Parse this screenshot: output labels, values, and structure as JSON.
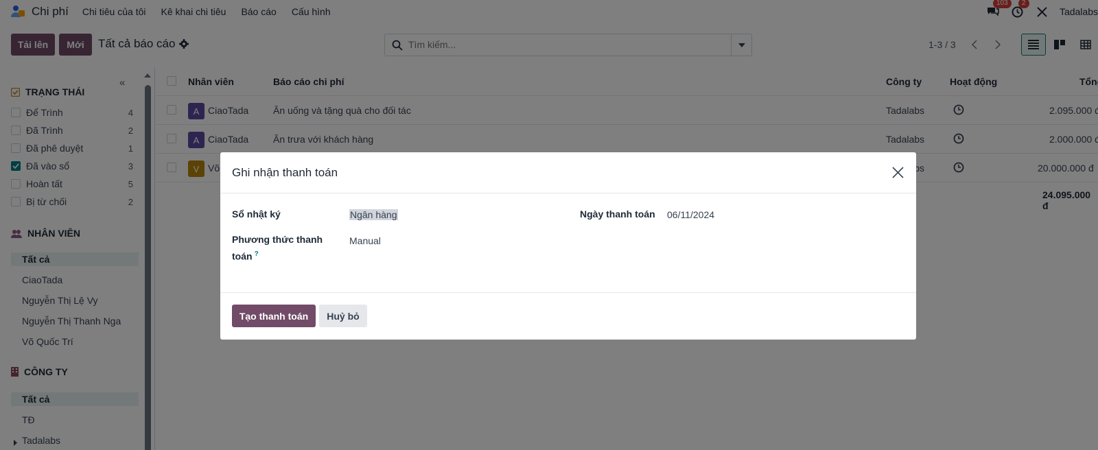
{
  "app": {
    "name": "Chi phí",
    "menu": [
      "Chi tiêu của tôi",
      "Kê khai chi tiêu",
      "Báo cáo",
      "Cấu hình"
    ],
    "messages_badge": "103",
    "activities_badge": "2",
    "company": "Tadalabs"
  },
  "control_panel": {
    "upload_label": "Tải lên",
    "new_label": "Mới",
    "title": "Tất cả báo cáo",
    "search_placeholder": "Tìm kiếm...",
    "pager": "1-3 / 3"
  },
  "sidebar": {
    "status_title": "TRẠNG THÁI",
    "statuses": [
      {
        "label": "Để Trình",
        "count": "4",
        "checked": false
      },
      {
        "label": "Đã Trình",
        "count": "2",
        "checked": false
      },
      {
        "label": "Đã phê duyệt",
        "count": "1",
        "checked": false
      },
      {
        "label": "Đã vào sổ",
        "count": "3",
        "checked": true
      },
      {
        "label": "Hoàn tất",
        "count": "5",
        "checked": false
      },
      {
        "label": "Bị từ chối",
        "count": "2",
        "checked": false
      }
    ],
    "employee_title": "NHÂN VIÊN",
    "employees": [
      "Tất cả",
      "CiaoTada",
      "Nguyễn Thị Lệ Vy",
      "Nguyễn Thị Thanh Nga",
      "Võ Quốc Trí"
    ],
    "company_title": "CÔNG TY",
    "companies": [
      "Tất cả",
      "TĐ",
      "Tadalabs"
    ]
  },
  "table": {
    "headers": {
      "employee": "Nhân viên",
      "report": "Báo cáo chi phí",
      "company": "Công ty",
      "activity": "Hoạt động",
      "total": "Tổng"
    },
    "rows": [
      {
        "avatar": "A",
        "avatar_color": "#5b4aa0",
        "employee": "CiaoTada",
        "report": "Ăn uống và tặng quà cho đối tác",
        "company": "Tadalabs",
        "total": "2.095.000 đ"
      },
      {
        "avatar": "A",
        "avatar_color": "#5b4aa0",
        "employee": "CiaoTada",
        "report": "Ăn trưa với khách hàng",
        "company": "Tadalabs",
        "total": "2.000.000 đ"
      },
      {
        "avatar": "V",
        "avatar_color": "#b8860b",
        "employee": "Võ Quốc Trí",
        "report": "",
        "company": "Tadalabs",
        "total": "20.000.000 đ"
      }
    ],
    "grand_total": "24.095.000 đ"
  },
  "modal": {
    "title": "Ghi nhận thanh toán",
    "journal_label": "Sổ nhật ký",
    "journal_value": "Ngân hàng",
    "method_label": "Phương thức thanh toán",
    "method_tip": "?",
    "method_value": "Manual",
    "date_label": "Ngày thanh toán",
    "date_value": "06/11/2024",
    "create_label": "Tạo thanh toán",
    "cancel_label": "Huỷ bỏ"
  },
  "colors": {
    "brand": "#714b67",
    "accent": "#017e84",
    "badge": "#d23f3a"
  }
}
